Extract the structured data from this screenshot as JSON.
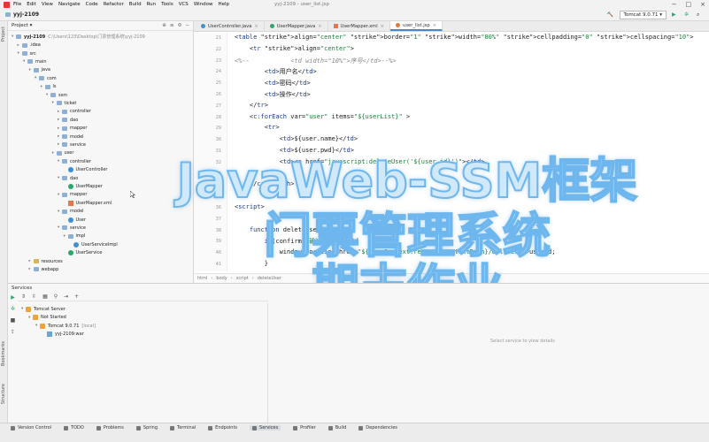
{
  "window": {
    "title": "yyj-2109 - user_list.jsp"
  },
  "menu": [
    "File",
    "Edit",
    "View",
    "Navigate",
    "Code",
    "Refactor",
    "Build",
    "Run",
    "Tools",
    "VCS",
    "Window",
    "Help"
  ],
  "toolbar": {
    "project": "yyj-2109",
    "run_config": "Tomcat 9.0.71"
  },
  "left_strip": {
    "project": "Project",
    "bookmarks": "Bookmarks",
    "structure": "Structure"
  },
  "project_panel": {
    "header": "Project",
    "tree": [
      {
        "label": "yyj-2109",
        "extra": "C:\\Users\\123\\Desktop\\门票管理系统\\yyj-2109",
        "level": 0,
        "icon": "folder",
        "open": true,
        "bold": true
      },
      {
        "label": ".idea",
        "level": 1,
        "icon": "folder",
        "open": false
      },
      {
        "label": "src",
        "level": 1,
        "icon": "folder",
        "open": true
      },
      {
        "label": "main",
        "level": 2,
        "icon": "folder",
        "open": true
      },
      {
        "label": "java",
        "level": 3,
        "icon": "folder",
        "open": true
      },
      {
        "label": "com",
        "level": 4,
        "icon": "folder",
        "open": true
      },
      {
        "label": "ls",
        "level": 5,
        "icon": "folder",
        "open": true
      },
      {
        "label": "ssm",
        "level": 6,
        "icon": "folder",
        "open": true
      },
      {
        "label": "ticket",
        "level": 7,
        "icon": "folder",
        "open": true
      },
      {
        "label": "controller",
        "level": 8,
        "icon": "folder",
        "open": false
      },
      {
        "label": "dao",
        "level": 8,
        "icon": "folder",
        "open": false
      },
      {
        "label": "mapper",
        "level": 8,
        "icon": "folder",
        "open": false
      },
      {
        "label": "model",
        "level": 8,
        "icon": "folder",
        "open": false
      },
      {
        "label": "service",
        "level": 8,
        "icon": "folder",
        "open": false
      },
      {
        "label": "user",
        "level": 7,
        "icon": "folder",
        "open": true
      },
      {
        "label": "controller",
        "level": 8,
        "icon": "folder",
        "open": true
      },
      {
        "label": "UserController",
        "level": 9,
        "icon": "class"
      },
      {
        "label": "dao",
        "level": 8,
        "icon": "folder",
        "open": true
      },
      {
        "label": "UserMapper",
        "level": 9,
        "icon": "interface"
      },
      {
        "label": "mapper",
        "level": 8,
        "icon": "folder",
        "open": true
      },
      {
        "label": "UserMapper.xml",
        "level": 9,
        "icon": "xml"
      },
      {
        "label": "model",
        "level": 8,
        "icon": "folder",
        "open": true
      },
      {
        "label": "User",
        "level": 9,
        "icon": "class"
      },
      {
        "label": "service",
        "level": 8,
        "icon": "folder",
        "open": true
      },
      {
        "label": "impl",
        "level": 9,
        "icon": "folder",
        "open": true
      },
      {
        "label": "UserServiceImpl",
        "level": 10,
        "icon": "class"
      },
      {
        "label": "UserService",
        "level": 9,
        "icon": "interface"
      },
      {
        "label": "resources",
        "level": 3,
        "icon": "folder-y",
        "open": false
      },
      {
        "label": "webapp",
        "level": 3,
        "icon": "folder",
        "open": false
      }
    ]
  },
  "editor": {
    "tabs": [
      {
        "label": "UserController.java",
        "icon": "java"
      },
      {
        "label": "UserMapper.java",
        "icon": "interface"
      },
      {
        "label": "UserMapper.xml",
        "icon": "xml"
      },
      {
        "label": "user_list.jsp",
        "icon": "jsp",
        "active": true
      }
    ],
    "line_numbers": [
      "21",
      "22",
      "23",
      "24",
      "25",
      "26",
      "27",
      "28",
      "29",
      "30",
      "31",
      "32",
      "33",
      "34",
      "35",
      "36",
      "37",
      "38",
      "39",
      "40",
      "41"
    ],
    "code_lines": [
      "<table align=\"center\" border=\"1\" width=\"80%\" cellpadding=\"0\" cellspacing=\"10\">",
      "    <tr align=\"center\">",
      "<%--           <td width=\"10%\">序号</td>--%>",
      "        <td>用户名</td>",
      "        <td>密码</td>",
      "        <td>操作</td>",
      "    </tr>",
      "    <c:forEach var=\"user\" items=\"${userList}\" >",
      "        <tr>",
      "            <td>${user.name}</td>",
      "            <td>${user.pwd}</td>",
      "            <td><a href=\"javascript:deleteUser('${user.id}')\"></td>",
      "        </tr>",
      "    </c:forEach>",
      "",
      "<script>",
      "",
      "    function deleteUser(userId){",
      "        if(confirm(\"确认删除吗?\")){",
      "            window.location.href=\"${pageContext.request.contextPath}/delUser/\"+userId;",
      "        }"
    ],
    "breadcrumb": [
      "html",
      "body",
      "script",
      "deleteUser"
    ]
  },
  "overlay": {
    "line1": "JavaWeb-SSM框架",
    "line2": "门票管理系统",
    "line3": "期末作业"
  },
  "services": {
    "header": "Services",
    "tree": [
      {
        "label": "Tomcat Server",
        "level": 0,
        "icon": "tomcat"
      },
      {
        "label": "Not Started",
        "level": 1,
        "icon": "status"
      },
      {
        "label": "Tomcat 9.0.71",
        "extra": "[local]",
        "level": 2,
        "icon": "tomcat"
      },
      {
        "label": "yyj-2109:war",
        "level": 3,
        "icon": "artifact"
      }
    ],
    "empty_text": "Select service to view details"
  },
  "statusbar": {
    "tabs": [
      {
        "label": "Version Control"
      },
      {
        "label": "TODO"
      },
      {
        "label": "Problems"
      },
      {
        "label": "Spring"
      },
      {
        "label": "Terminal"
      },
      {
        "label": "Endpoints"
      },
      {
        "label": "Services",
        "active": true
      },
      {
        "label": "Profiler"
      },
      {
        "label": "Build"
      },
      {
        "label": "Dependencies"
      }
    ]
  }
}
